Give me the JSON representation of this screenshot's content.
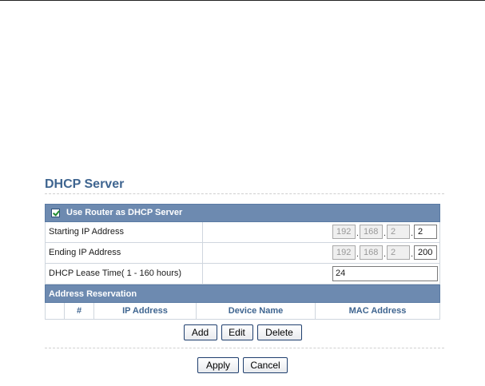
{
  "section_title": "DHCP Server",
  "use_router": {
    "label": "Use Router as DHCP Server",
    "checked": true
  },
  "starting_ip": {
    "label": "Starting IP Address",
    "octets": [
      "192",
      "168",
      "2",
      "2"
    ]
  },
  "ending_ip": {
    "label": "Ending IP Address",
    "octets": [
      "192",
      "168",
      "2",
      "200"
    ]
  },
  "lease": {
    "label": "DHCP Lease Time( 1 - 160 hours)",
    "value": "24"
  },
  "reservation": {
    "title": "Address Reservation",
    "columns": [
      "#",
      "IP Address",
      "Device Name",
      "MAC Address"
    ]
  },
  "buttons": {
    "add": "Add",
    "edit": "Edit",
    "delete": "Delete",
    "apply": "Apply",
    "cancel": "Cancel"
  }
}
